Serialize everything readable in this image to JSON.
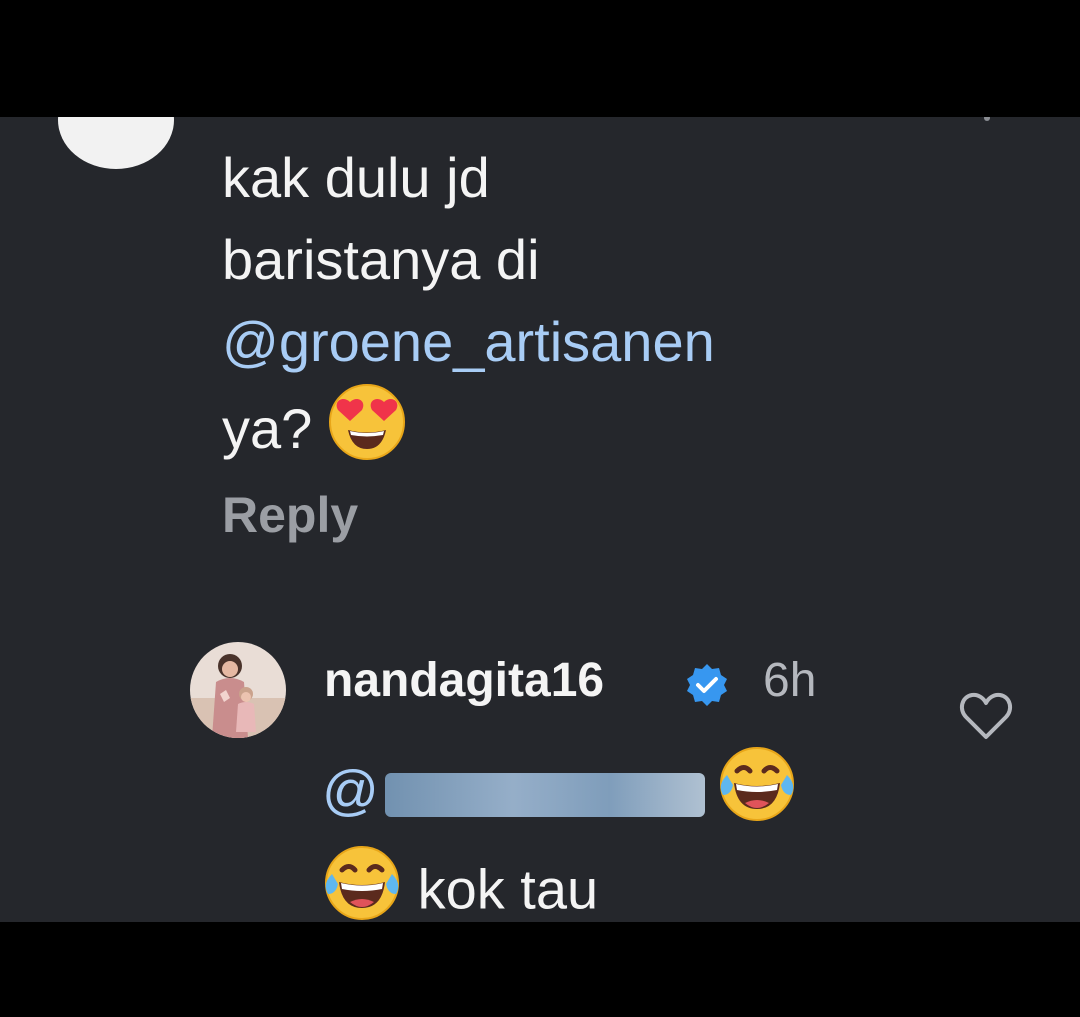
{
  "parent_comment": {
    "text_line_1": "kak dulu jd",
    "text_line_2": "baristanya di",
    "mention": "@groene_artisanen",
    "text_line_4": "ya?",
    "emoji_icon": "heart-eyes-emoji-icon",
    "reply_label": "Reply"
  },
  "reply_comment": {
    "username": "nandagita16",
    "verified_icon": "verified-badge-icon",
    "time": "6h",
    "mention_prefix": "@",
    "emoji_icon": "laughing-tears-emoji-icon",
    "text": "kok tau",
    "like_icon": "heart-outline-icon"
  },
  "colors": {
    "background": "#25272c",
    "text": "#f4f4f4",
    "mention": "#a8ccf5",
    "muted": "#9b9ea4",
    "verified": "#3797f0"
  }
}
